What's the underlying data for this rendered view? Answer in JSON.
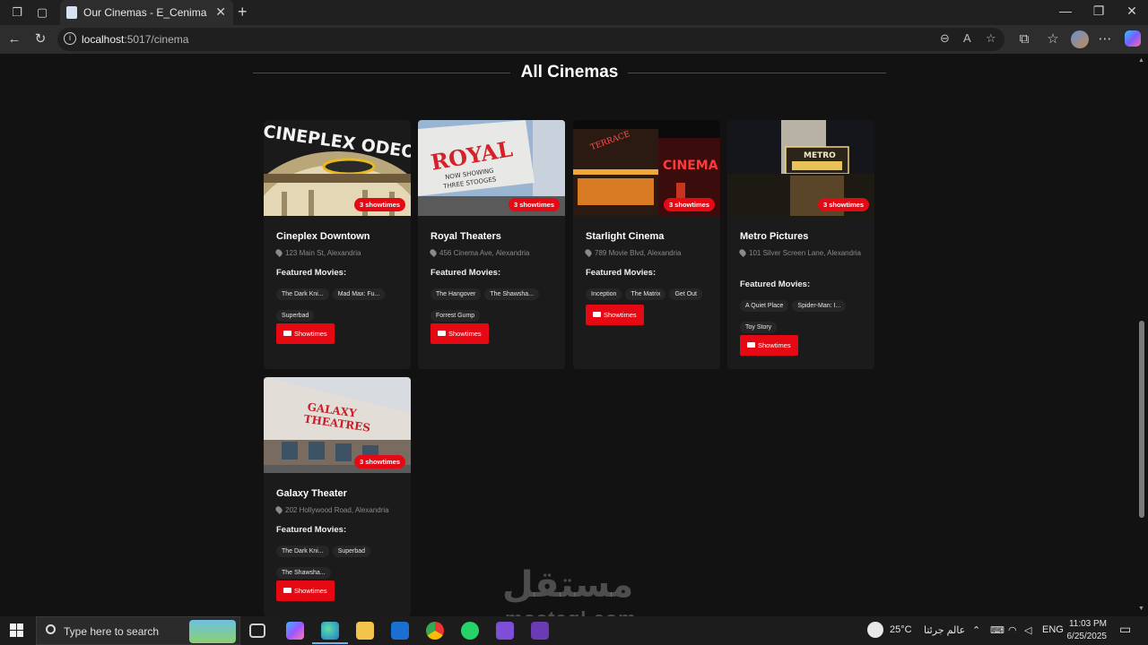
{
  "browser": {
    "tab_title": "Our Cinemas - E_Cenima",
    "url_host": "localhost",
    "url_rest": ":5017/cinema"
  },
  "page": {
    "heading": "All Cinemas",
    "featured_label": "Featured Movies:",
    "showtimes_button": "Showtimes",
    "cinemas": [
      {
        "name": "Cineplex Downtown",
        "address": "123 Main St, Alexandria",
        "badge": "3 showtimes",
        "movies": [
          "The Dark Kni...",
          "Mad Max: Fu...",
          "Superbad"
        ]
      },
      {
        "name": "Royal Theaters",
        "address": "456 Cinema Ave, Alexandria",
        "badge": "3 showtimes",
        "movies": [
          "The Hangover",
          "The Shawsha...",
          "Forrest Gump"
        ]
      },
      {
        "name": "Starlight Cinema",
        "address": "789 Movie Blvd, Alexandria",
        "badge": "3 showtimes",
        "movies": [
          "Inception",
          "The Matrix",
          "Get Out"
        ]
      },
      {
        "name": "Metro Pictures",
        "address": "101 Silver Screen Lane, Alexandria",
        "badge": "3 showtimes",
        "movies": [
          "A Quiet Place",
          "Spider-Man: I...",
          "Toy Story"
        ]
      },
      {
        "name": "Galaxy Theater",
        "address": "202 Hollywood Road, Alexandria",
        "badge": "3 showtimes",
        "movies": [
          "The Dark Kni...",
          "Superbad",
          "The Shawsha..."
        ]
      }
    ]
  },
  "watermark": {
    "arabic": "مستقل",
    "latin": "mostaql.com"
  },
  "taskbar": {
    "search_placeholder": "Type here to search",
    "weather": "25°C",
    "weather_text": "عالم جرئتا",
    "language": "ENG",
    "time": "11:03 PM",
    "date": "6/25/2025"
  },
  "colors": {
    "accent": "#e50914",
    "page_bg": "#121212",
    "card_bg": "#1b1b1b"
  }
}
